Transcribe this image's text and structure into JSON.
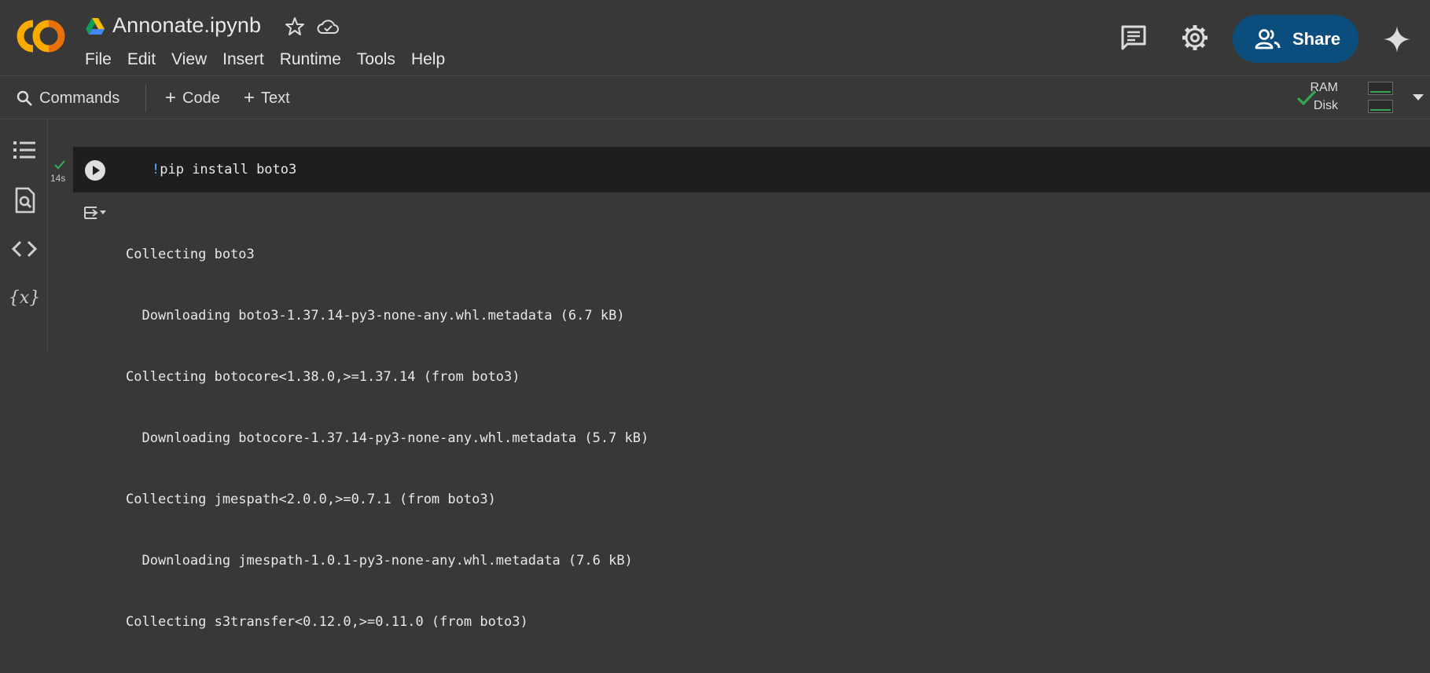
{
  "header": {
    "title": "Annonate.ipynb",
    "menu": [
      "File",
      "Edit",
      "View",
      "Insert",
      "Runtime",
      "Tools",
      "Help"
    ],
    "share_label": "Share",
    "icons": [
      "colab-logo",
      "drive-icon",
      "star-icon",
      "cloud-icon",
      "comment-icon",
      "gear-icon",
      "share-people-icon",
      "gemini-sparkle-icon"
    ]
  },
  "toolbar": {
    "commands_label": "Commands",
    "code_label": "Code",
    "text_label": "Text",
    "ram_label": "RAM",
    "disk_label": "Disk",
    "connected": true
  },
  "sidebar": {
    "icons": [
      "toc-icon",
      "find-icon",
      "code-snippets-icon",
      "variables-icon"
    ]
  },
  "cell": {
    "code_bang": "!",
    "code_rest": "pip install boto3",
    "exec_time": "14s",
    "output_lines": [
      "Collecting boto3",
      "  Downloading boto3-1.37.14-py3-none-any.whl.metadata (6.7 kB)",
      "Collecting botocore<1.38.0,>=1.37.14 (from boto3)",
      "  Downloading botocore-1.37.14-py3-none-any.whl.metadata (5.7 kB)",
      "Collecting jmespath<2.0.0,>=0.7.1 (from boto3)",
      "  Downloading jmespath-1.0.1-py3-none-any.whl.metadata (7.6 kB)",
      "Collecting s3transfer<0.12.0,>=0.11.0 (from boto3)"
    ]
  },
  "colors": {
    "background": "#383838",
    "code_cell": "#1e1e1e",
    "share_button": "#0b4e7e",
    "logo_orange": "#f9ab00",
    "logo_dark_orange": "#e8710a",
    "success_green": "#34a853"
  }
}
